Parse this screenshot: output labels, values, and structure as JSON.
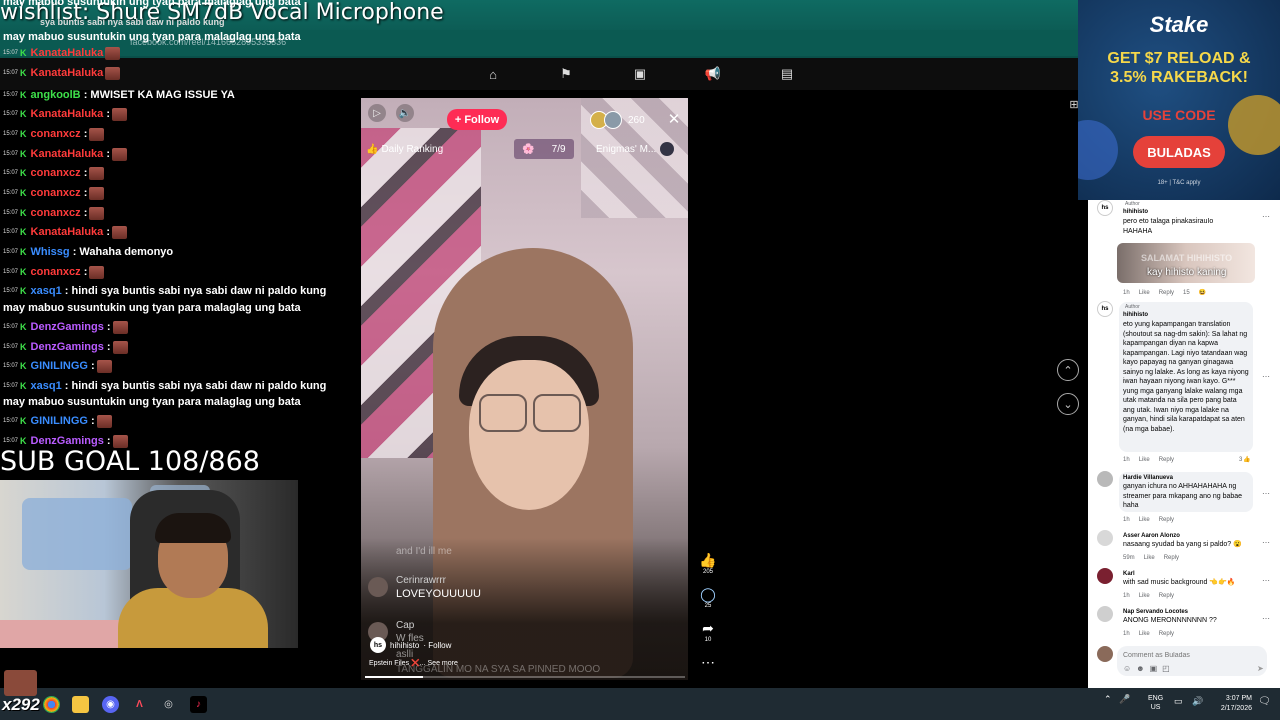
{
  "overlay": {
    "wishlist": "wishlist: Shure SM7dB Vocal Microphone",
    "url_ghost": "facebook.com/reel/1416652895335336",
    "sub_goal": "SUB GOAL 108/868",
    "x292": "x292"
  },
  "chat": {
    "timestamp": "15:07",
    "top_wrap": [
      "may mabuo susuntukin ung tyan para malaglag ung bata",
      "sya buntis sabi nya sabi daw ni paldo kung",
      "may mabuo susuntukin ung tyan para malaglag ung bata"
    ],
    "lines": [
      {
        "user": "KanataHaluka",
        "color": "#ff3b3b",
        "msg": "",
        "emote": true
      },
      {
        "user": "KanataHaluka",
        "color": "#ff3b3b",
        "msg": "",
        "emote": true
      },
      {
        "user": "angkoolB",
        "color": "#3ee04a",
        "msg": ": MWISET KA MAG ISSUE YA",
        "emote": false
      },
      {
        "user": "KanataHaluka",
        "color": "#ff3b3b",
        "msg": ":",
        "emote": true
      },
      {
        "user": "conanxcz",
        "color": "#ff3b3b",
        "msg": ":",
        "emote": true
      },
      {
        "user": "KanataHaluka",
        "color": "#ff3b3b",
        "msg": ":",
        "emote": true
      },
      {
        "user": "conanxcz",
        "color": "#ff3b3b",
        "msg": ":",
        "emote": true
      },
      {
        "user": "conanxcz",
        "color": "#ff3b3b",
        "msg": ":",
        "emote": true
      },
      {
        "user": "conanxcz",
        "color": "#ff3b3b",
        "msg": ":",
        "emote": true
      },
      {
        "user": "KanataHaluka",
        "color": "#ff3b3b",
        "msg": ":",
        "emote": true
      },
      {
        "user": "Whissg",
        "color": "#3a8dff",
        "msg": ": Wahaha demonyo",
        "emote": false
      },
      {
        "user": "conanxcz",
        "color": "#ff3b3b",
        "msg": ":",
        "emote": true
      },
      {
        "user": "xasq1",
        "color": "#3a8dff",
        "msg": ": hindi sya buntis sabi nya sabi daw ni paldo kung",
        "emote": false
      },
      {
        "user": "DenzGamings",
        "color": "#b95cff",
        "msg": ":",
        "emote": true
      },
      {
        "user": "DenzGamings",
        "color": "#b95cff",
        "msg": ":",
        "emote": true
      },
      {
        "user": "GINILINGG",
        "color": "#3a8dff",
        "msg": ":",
        "emote": true
      },
      {
        "user": "xasq1",
        "color": "#3a8dff",
        "msg": ": hindi sya buntis sabi nya sabi daw ni paldo kung",
        "emote": false
      },
      {
        "user": "GINILINGG",
        "color": "#3a8dff",
        "msg": ":",
        "emote": true
      },
      {
        "user": "DenzGamings",
        "color": "#b95cff",
        "msg": ":",
        "emote": true
      }
    ],
    "wrap_line": "may mabuo susuntukin ung tyan para malaglag ung bata"
  },
  "video": {
    "follow": "+ Follow",
    "viewer_count": "260",
    "close": "✕",
    "daily_ranking": "Daily Ranking",
    "rank": "7/9",
    "enigmas": "Enigmas' M...",
    "ghost_top": "and I'd ill me",
    "comment1_user": "Cerinrawrrr",
    "comment1_text": "LOVEYOUUUUU",
    "comment2_user": "Cap",
    "comment2_text": "W fles",
    "comment3_text": "aslli",
    "creator": "hihihisto",
    "creator_follow": "· Follow",
    "caption": "Epstein Files ❌... See more",
    "pinned_ghost": "TANGGALIN MO NA SYA SA PINNED MOOO",
    "progress": 0.18,
    "likes": "205",
    "comments": "25",
    "shares": "10"
  },
  "ad": {
    "logo": "Stake",
    "head1": "GET $7 RELOAD &",
    "head2": "3.5% RAKEBACK!",
    "use_code": "USE CODE",
    "code": "BULADAS",
    "tc": "18+ | T&C apply"
  },
  "fb": {
    "author_tag": "Author",
    "c1": {
      "name": "hihihisto",
      "text": "pero eto talaga pinakasirauIo HAHAHA",
      "time": "1h",
      "like": "Like",
      "reply": "Reply",
      "count": "15"
    },
    "sticker_bg": "SALAMAT HIHIHISTO",
    "sticker_fg": "kay hihisto kaning",
    "c2": {
      "name": "hihihisto",
      "text": "eto yung kapampangan translation (shoutout sa nag-dm sakin): Sa lahat ng kapampangan diyan na kapwa kapampangan. Lagi niyo tatandaan wag kayo papayag na ganyan ginagawa sainyo ng lalake. As long as kaya niyong iwan hayaan niyong iwan kayo. G*** yung mga ganyang lalake walang mga utak matanda na sila pero pang bata ang utak. Iwan niyo mga lalake na ganyan, hindi sila karapatdapat sa aten (na mga babae).",
      "time": "1h",
      "like": "Like",
      "reply": "Reply",
      "count": "3"
    },
    "c3": {
      "name": "Hardie Villanueva",
      "text": "ganyan ichura no AHHAHAHAHA ng streamer para mkapang ano ng babae haha",
      "time": "1h",
      "like": "Like",
      "reply": "Reply"
    },
    "c4": {
      "name": "Asser Aaron Alonzo",
      "text": "nasaang syudad ba yang si paldo? 😮",
      "time": "59m",
      "like": "Like",
      "reply": "Reply"
    },
    "c5": {
      "name": "Karl",
      "text": "with sad music background 👈👉🔥",
      "time": "1h",
      "like": "Like",
      "reply": "Reply"
    },
    "c6": {
      "name": "Nap Servando Locotes",
      "text": "ANONG MERONNNNNNN ??",
      "time": "1h",
      "like": "Like",
      "reply": "Reply"
    },
    "comment_placeholder": "Comment as Buladas"
  },
  "taskbar": {
    "lang_top": "ENG",
    "lang_bottom": "US",
    "time": "3:07 PM",
    "date": "2/17/2026"
  }
}
